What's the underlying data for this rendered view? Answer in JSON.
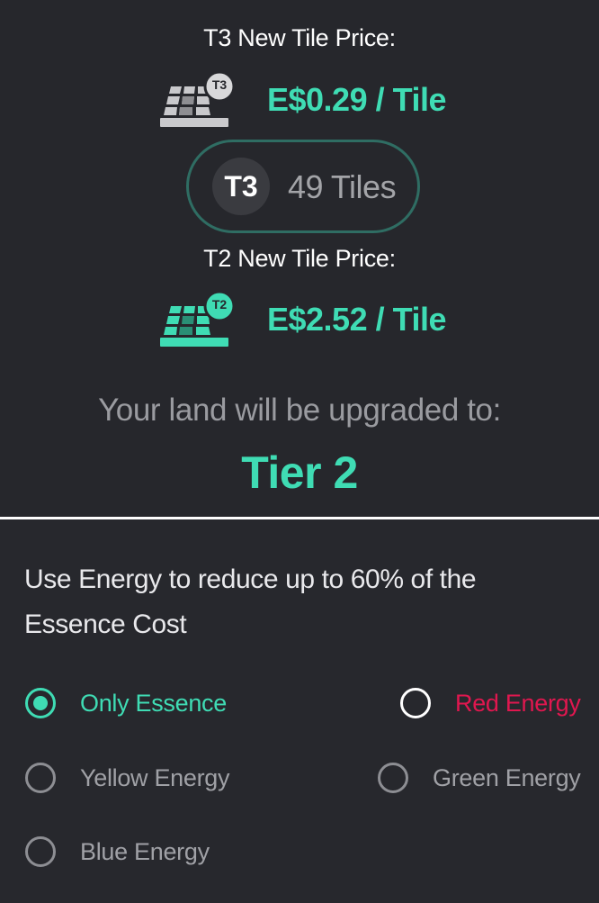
{
  "upgrade": {
    "t3_price_label": "T3 New Tile Price:",
    "t3_price": "E$0.29 / Tile",
    "t3_icon_badge": "T3",
    "current_tier_badge": "T3",
    "tile_count": "49 Tiles",
    "t2_price_label": "T2 New Tile Price:",
    "t2_price": "E$2.52 / Tile",
    "t2_icon_badge": "T2",
    "upgrade_label": "Your land will be upgraded to:",
    "target_tier": "Tier 2"
  },
  "energy": {
    "description": "Use Energy to reduce up to 60% of the Essence Cost",
    "options": [
      {
        "label": "Only Essence",
        "selected": true,
        "color": "#3fdcb4"
      },
      {
        "label": "Red Energy",
        "selected": false,
        "color": "#e0174f"
      },
      {
        "label": "Yellow Energy",
        "selected": false,
        "color": "#a0a1a6"
      },
      {
        "label": "Green Energy",
        "selected": false,
        "color": "#a0a1a6"
      },
      {
        "label": "Blue Energy",
        "selected": false,
        "color": "#a0a1a6"
      }
    ]
  },
  "colors": {
    "accent": "#3fdcb4",
    "background": "#26272c",
    "red": "#e0174f"
  }
}
